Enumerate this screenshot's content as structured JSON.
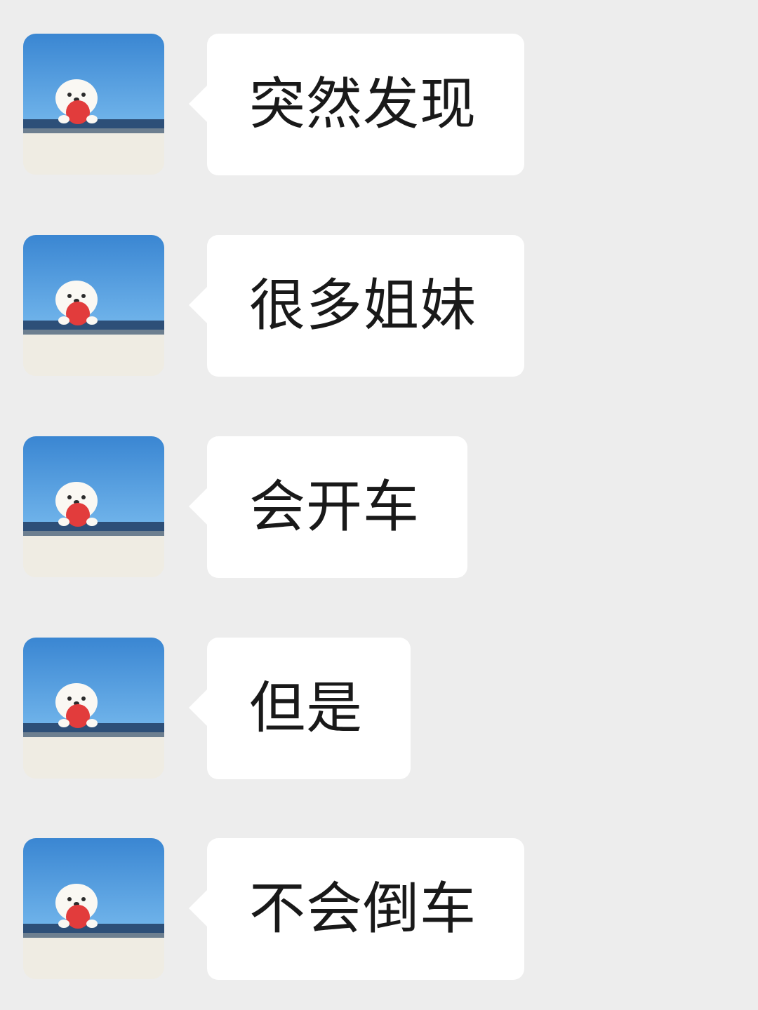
{
  "chat": {
    "messages": [
      {
        "text": "突然发现",
        "avatar_icon": "puppy-avatar-icon"
      },
      {
        "text": "很多姐妹",
        "avatar_icon": "puppy-avatar-icon"
      },
      {
        "text": "会开车",
        "avatar_icon": "puppy-avatar-icon"
      },
      {
        "text": "但是",
        "avatar_icon": "puppy-avatar-icon"
      },
      {
        "text": "不会倒车",
        "avatar_icon": "puppy-avatar-icon"
      }
    ]
  },
  "colors": {
    "background": "#ededed",
    "bubble": "#ffffff",
    "text": "#191919",
    "avatar_sky": "#3f8fd8",
    "avatar_ball": "#e03a3a"
  }
}
